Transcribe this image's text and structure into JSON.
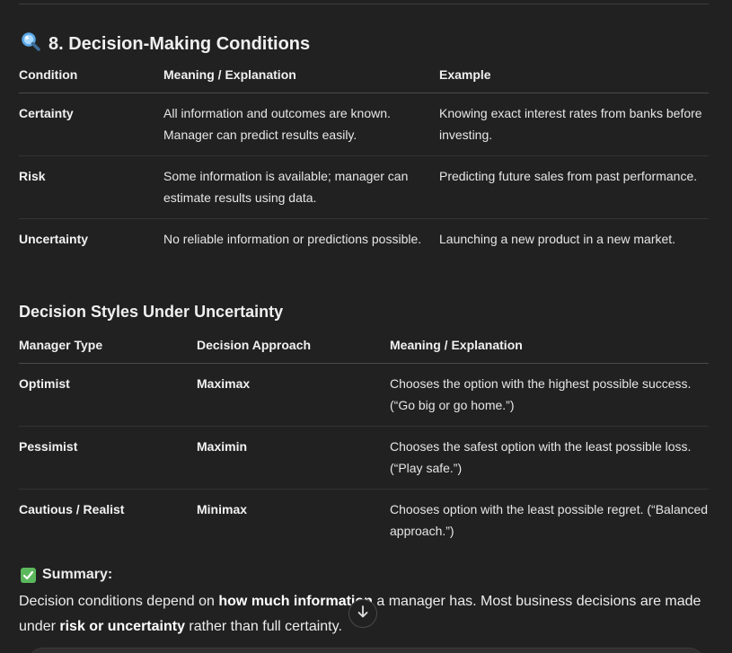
{
  "section": {
    "icon": "magnifier-icon",
    "title": "8. Decision-Making Conditions"
  },
  "conditions_table": {
    "headers": [
      "Condition",
      "Meaning / Explanation",
      "Example"
    ],
    "rows": [
      [
        "Certainty",
        "All information and outcomes are known. Manager can predict results easily.",
        "Knowing exact interest rates from banks before investing."
      ],
      [
        "Risk",
        "Some information is available; manager can estimate results using data.",
        "Predicting future sales from past performance."
      ],
      [
        "Uncertainty",
        "No reliable information or predictions possible.",
        "Launching a new product in a new market."
      ]
    ]
  },
  "styles_section": {
    "title": "Decision Styles Under Uncertainty"
  },
  "styles_table": {
    "headers": [
      "Manager Type",
      "Decision Approach",
      "Meaning / Explanation"
    ],
    "rows": [
      [
        "Optimist",
        "Maximax",
        "Chooses the option with the highest possible success. (“Go big or go home.”)"
      ],
      [
        "Pessimist",
        "Maximin",
        "Chooses the safest option with the least possible loss. (“Play safe.”)"
      ],
      [
        "Cautious / Realist",
        "Minimax",
        "Chooses option with the least possible regret. (“Balanced approach.”)"
      ]
    ]
  },
  "summary": {
    "icon": "check-mark-icon",
    "title": "Summary:",
    "part1": "Decision conditions depend on ",
    "bold1": "how much information",
    "part2": " a manager has. Most business decisions are made under ",
    "bold2": "risk or uncertainty",
    "part3": " rather than full certainty."
  },
  "scroll_button": {
    "icon": "arrow-down-icon"
  },
  "colors": {
    "background": "#212121",
    "text": "#ececec",
    "check_green": "#5cb85c",
    "magnifier_blue": "#6cb4ee"
  }
}
